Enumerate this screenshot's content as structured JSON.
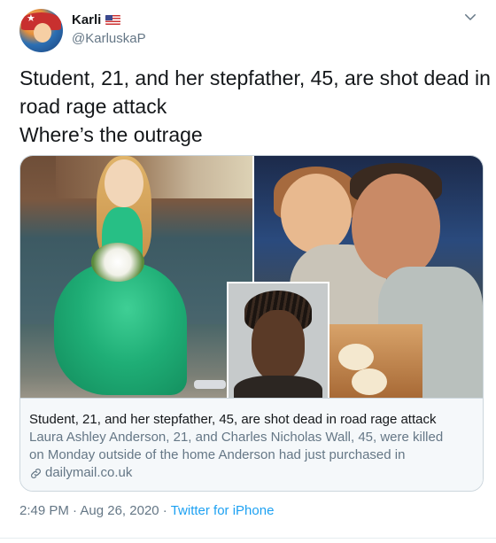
{
  "author": {
    "display_name": "Karli",
    "flag": "🇺🇸",
    "handle": "@KarluskaP"
  },
  "tweet": {
    "lines": [
      "Student, 21, and her stepfather, 45, are shot dead in",
      "road rage attack",
      "Where’s the outrage"
    ]
  },
  "card": {
    "title": "Student, 21, and her stepfather, 45, are shot dead in road rage attack",
    "description_lines": [
      "Laura Ashley Anderson, 21, and Charles Nicholas Wall, 45, were killed",
      "on Monday outside of the home Anderson had just purchased in"
    ],
    "domain": "dailymail.co.uk",
    "domain_icon": "link-icon"
  },
  "meta": {
    "time": "2:49 PM",
    "separator": " · ",
    "date": "Aug 26, 2020",
    "source": "Twitter for iPhone"
  },
  "colors": {
    "text": "#14171a",
    "secondary": "#657786",
    "link": "#1da1f2",
    "border": "#ccd6dd",
    "card_bg": "#f5f8fa"
  }
}
